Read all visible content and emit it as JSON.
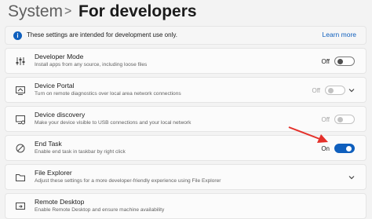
{
  "header": {
    "breadcrumb_root": "System",
    "separator": ">",
    "page_title": "For developers"
  },
  "info": {
    "text": "These settings are intended for development use only.",
    "link": "Learn more",
    "icon": "info-icon"
  },
  "rows": [
    {
      "title": "Developer Mode",
      "subtitle": "Install apps from any source, including loose files",
      "icon": "developer-mode-icon",
      "state_label": "Off",
      "state": "off",
      "enabled": true
    },
    {
      "title": "Device Portal",
      "subtitle": "Turn on remote diagnostics over local area network connections",
      "icon": "device-portal-icon",
      "state_label": "Off",
      "state": "off",
      "enabled": false
    },
    {
      "title": "Device discovery",
      "subtitle": "Make your device visible to USB connections and your local network",
      "icon": "device-discovery-icon",
      "state_label": "Off",
      "state": "off",
      "enabled": false
    },
    {
      "title": "End Task",
      "subtitle": "Enable end task in taskbar by right click",
      "icon": "end-task-icon",
      "state_label": "On",
      "state": "on",
      "enabled": true
    },
    {
      "title": "File Explorer",
      "subtitle": "Adjust these settings for a more developer-friendly experience using File Explorer",
      "icon": "folder-icon"
    },
    {
      "title": "Remote Desktop",
      "subtitle": "Enable Remote Desktop and ensure machine availability",
      "icon": "remote-desktop-icon"
    }
  ],
  "colors": {
    "accent": "#0f5fbd",
    "annotation_arrow": "#e4302a"
  }
}
